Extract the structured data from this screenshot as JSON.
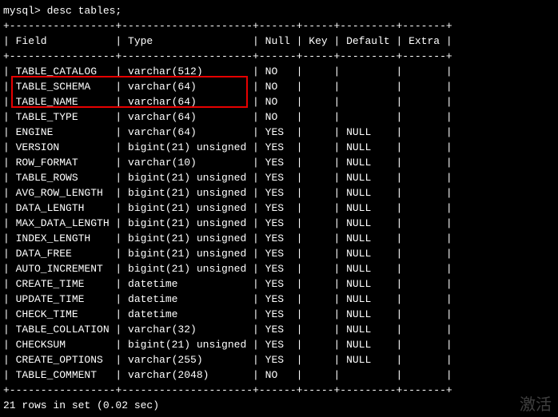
{
  "prompt": "mysql> desc tables;",
  "headers": {
    "field": "Field",
    "type": "Type",
    "null": "Null",
    "key": "Key",
    "default": "Default",
    "extra": "Extra"
  },
  "rows": [
    {
      "field": "TABLE_CATALOG",
      "type": "varchar(512)",
      "null": "NO",
      "key": "",
      "default": "",
      "extra": ""
    },
    {
      "field": "TABLE_SCHEMA",
      "type": "varchar(64)",
      "null": "NO",
      "key": "",
      "default": "",
      "extra": ""
    },
    {
      "field": "TABLE_NAME",
      "type": "varchar(64)",
      "null": "NO",
      "key": "",
      "default": "",
      "extra": ""
    },
    {
      "field": "TABLE_TYPE",
      "type": "varchar(64)",
      "null": "NO",
      "key": "",
      "default": "",
      "extra": ""
    },
    {
      "field": "ENGINE",
      "type": "varchar(64)",
      "null": "YES",
      "key": "",
      "default": "NULL",
      "extra": ""
    },
    {
      "field": "VERSION",
      "type": "bigint(21) unsigned",
      "null": "YES",
      "key": "",
      "default": "NULL",
      "extra": ""
    },
    {
      "field": "ROW_FORMAT",
      "type": "varchar(10)",
      "null": "YES",
      "key": "",
      "default": "NULL",
      "extra": ""
    },
    {
      "field": "TABLE_ROWS",
      "type": "bigint(21) unsigned",
      "null": "YES",
      "key": "",
      "default": "NULL",
      "extra": ""
    },
    {
      "field": "AVG_ROW_LENGTH",
      "type": "bigint(21) unsigned",
      "null": "YES",
      "key": "",
      "default": "NULL",
      "extra": ""
    },
    {
      "field": "DATA_LENGTH",
      "type": "bigint(21) unsigned",
      "null": "YES",
      "key": "",
      "default": "NULL",
      "extra": ""
    },
    {
      "field": "MAX_DATA_LENGTH",
      "type": "bigint(21) unsigned",
      "null": "YES",
      "key": "",
      "default": "NULL",
      "extra": ""
    },
    {
      "field": "INDEX_LENGTH",
      "type": "bigint(21) unsigned",
      "null": "YES",
      "key": "",
      "default": "NULL",
      "extra": ""
    },
    {
      "field": "DATA_FREE",
      "type": "bigint(21) unsigned",
      "null": "YES",
      "key": "",
      "default": "NULL",
      "extra": ""
    },
    {
      "field": "AUTO_INCREMENT",
      "type": "bigint(21) unsigned",
      "null": "YES",
      "key": "",
      "default": "NULL",
      "extra": ""
    },
    {
      "field": "CREATE_TIME",
      "type": "datetime",
      "null": "YES",
      "key": "",
      "default": "NULL",
      "extra": ""
    },
    {
      "field": "UPDATE_TIME",
      "type": "datetime",
      "null": "YES",
      "key": "",
      "default": "NULL",
      "extra": ""
    },
    {
      "field": "CHECK_TIME",
      "type": "datetime",
      "null": "YES",
      "key": "",
      "default": "NULL",
      "extra": ""
    },
    {
      "field": "TABLE_COLLATION",
      "type": "varchar(32)",
      "null": "YES",
      "key": "",
      "default": "NULL",
      "extra": ""
    },
    {
      "field": "CHECKSUM",
      "type": "bigint(21) unsigned",
      "null": "YES",
      "key": "",
      "default": "NULL",
      "extra": ""
    },
    {
      "field": "CREATE_OPTIONS",
      "type": "varchar(255)",
      "null": "YES",
      "key": "",
      "default": "NULL",
      "extra": ""
    },
    {
      "field": "TABLE_COMMENT",
      "type": "varchar(2048)",
      "null": "NO",
      "key": "",
      "default": "",
      "extra": ""
    }
  ],
  "footer": "21 rows in set (0.02 sec)",
  "watermark": "激活",
  "border_segments": {
    "sep_line": "+-----------------+---------------------+------+-----+---------+-------+"
  },
  "col_widths": {
    "field": 15,
    "type": 19,
    "null": 4,
    "key": 3,
    "default": 7,
    "extra": 5
  }
}
